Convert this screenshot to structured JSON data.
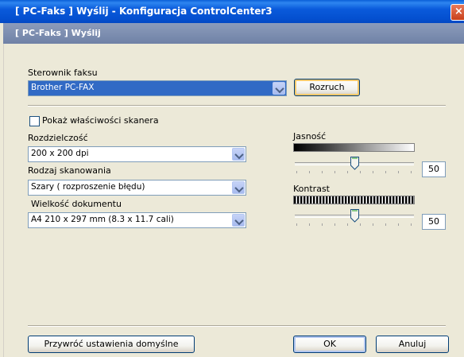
{
  "window": {
    "title": "[ PC-Faks ]  Wyślij - Konfiguracja ControlCenter3",
    "close": "×"
  },
  "panel": {
    "header": "[ PC-Faks ]  Wyślij"
  },
  "fax_driver": {
    "label": "Sterownik faksu",
    "value": "Brother PC-FAX",
    "start_button": "Rozruch"
  },
  "scanner": {
    "show_properties_label": "Pokaż właściwości skanera",
    "show_properties_checked": false,
    "resolution": {
      "label": "Rozdzielczość",
      "value": "200 x 200 dpi"
    },
    "scan_type": {
      "label": "Rodzaj skanowania",
      "value": "Szary ( rozproszenie błędu)"
    },
    "document_size": {
      "label": "Wielkość dokumentu",
      "value": "A4 210 x 297 mm (8.3 x 11.7 cali)"
    },
    "brightness": {
      "label": "Jasność",
      "value": "50",
      "level": 0.5
    },
    "contrast": {
      "label": "Kontrast",
      "value": "50",
      "level": 0.5
    }
  },
  "footer": {
    "restore_defaults": "Przywróć ustawienia domyślne",
    "ok": "OK",
    "cancel": "Anuluj"
  }
}
